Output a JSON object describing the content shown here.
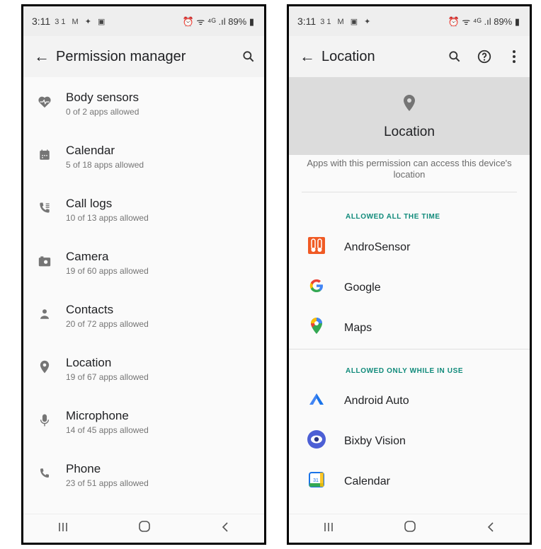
{
  "left": {
    "status": {
      "time": "3:11",
      "notif_icons": "31 M ✦ ▣",
      "right": "⏰ ᯤ ⁴ᴳ .ıl 89% ▮"
    },
    "appbar": {
      "title": "Permission manager"
    },
    "permissions": [
      {
        "name": "Body sensors",
        "sub": "0 of 2 apps allowed",
        "icon": "heart-pulse-icon"
      },
      {
        "name": "Calendar",
        "sub": "5 of 18 apps allowed",
        "icon": "calendar-icon"
      },
      {
        "name": "Call logs",
        "sub": "10 of 13 apps allowed",
        "icon": "call-log-icon"
      },
      {
        "name": "Camera",
        "sub": "19 of 60 apps allowed",
        "icon": "camera-icon"
      },
      {
        "name": "Contacts",
        "sub": "20 of 72 apps allowed",
        "icon": "person-icon"
      },
      {
        "name": "Location",
        "sub": "19 of 67 apps allowed",
        "icon": "location-pin-icon"
      },
      {
        "name": "Microphone",
        "sub": "14 of 45 apps allowed",
        "icon": "microphone-icon"
      },
      {
        "name": "Phone",
        "sub": "23 of 51 apps allowed",
        "icon": "phone-icon"
      }
    ]
  },
  "right": {
    "status": {
      "time": "3:11",
      "notif_icons": "31 M ▣ ✦",
      "right": "⏰ ᯤ ⁴ᴳ .ıl 89% ▮"
    },
    "appbar": {
      "title": "Location"
    },
    "header": {
      "title": "Location",
      "description": "Apps with this permission can access this device's location"
    },
    "sections": [
      {
        "label": "ALLOWED ALL THE TIME",
        "apps": [
          "AndroSensor",
          "Google",
          "Maps"
        ]
      },
      {
        "label": "ALLOWED ONLY WHILE IN USE",
        "apps": [
          "Android Auto",
          "Bixby Vision",
          "Calendar"
        ]
      }
    ]
  },
  "colors": {
    "accent_teal": "#0f8a7a",
    "header_gray": "#dcdcdc",
    "icon_gray": "#757575"
  }
}
